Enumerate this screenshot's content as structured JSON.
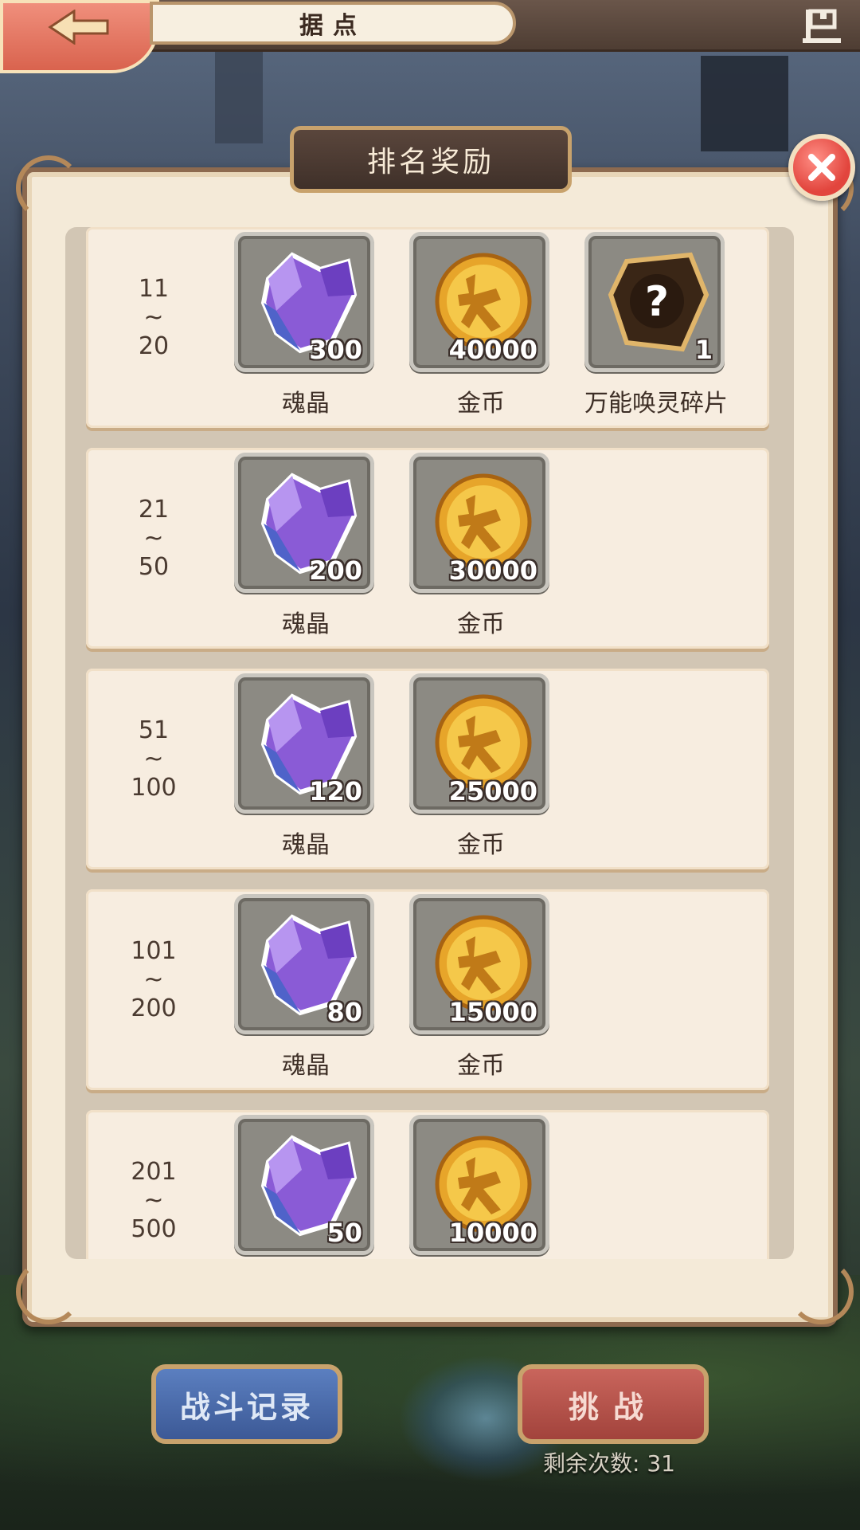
{
  "header": {
    "title": "据点"
  },
  "dialog": {
    "title": "排名奖励"
  },
  "rewards": [
    {
      "rank": [
        "11",
        "~",
        "20"
      ],
      "items": [
        {
          "name": "魂晶",
          "qty": "300",
          "icon": "soul-crystal-icon"
        },
        {
          "name": "金币",
          "qty": "40000",
          "icon": "gold-coin-icon"
        },
        {
          "name": "万能唤灵碎片",
          "qty": "1",
          "icon": "summon-shard-icon"
        }
      ]
    },
    {
      "rank": [
        "21",
        "~",
        "50"
      ],
      "items": [
        {
          "name": "魂晶",
          "qty": "200",
          "icon": "soul-crystal-icon"
        },
        {
          "name": "金币",
          "qty": "30000",
          "icon": "gold-coin-icon"
        }
      ]
    },
    {
      "rank": [
        "51",
        "~",
        "100"
      ],
      "items": [
        {
          "name": "魂晶",
          "qty": "120",
          "icon": "soul-crystal-icon"
        },
        {
          "name": "金币",
          "qty": "25000",
          "icon": "gold-coin-icon"
        }
      ]
    },
    {
      "rank": [
        "101",
        "~",
        "200"
      ],
      "items": [
        {
          "name": "魂晶",
          "qty": "80",
          "icon": "soul-crystal-icon"
        },
        {
          "name": "金币",
          "qty": "15000",
          "icon": "gold-coin-icon"
        }
      ]
    },
    {
      "rank": [
        "201",
        "~",
        "500"
      ],
      "items": [
        {
          "name": "魂晶",
          "qty": "50",
          "icon": "soul-crystal-icon"
        },
        {
          "name": "金币",
          "qty": "10000",
          "icon": "gold-coin-icon"
        }
      ]
    }
  ],
  "footer": {
    "record_label": "战斗记录",
    "challenge_label": "挑战",
    "remaining_label": "剩余次数: 31"
  }
}
